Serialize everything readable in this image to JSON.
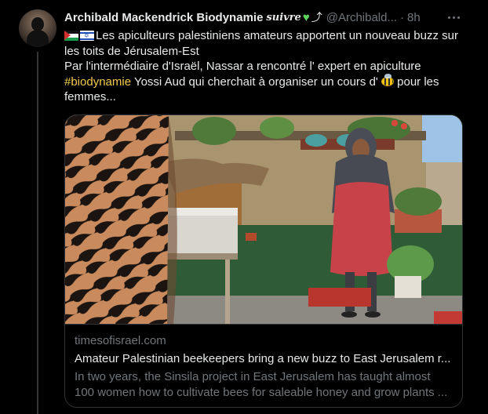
{
  "tweet": {
    "author_name": "Archibald Mackendrick Biodynamie",
    "author_suffix": "suivre",
    "handle": "@Archibald...",
    "separator": "·",
    "time": "8h",
    "text_lines": {
      "l1": "Les apiculteurs palestiniens amateurs apportent un nouveau buzz sur",
      "l2": "les toits de Jérusalem-Est",
      "l3": "Par l'intermédiaire d'Israël, Nassar a rencontré l' expert en apiculture",
      "l4_hashtag": "#biodynamie",
      "l4_rest": " Yossi Aud qui cherchait à organiser un cours d' ",
      "l4_end": " pour les",
      "l5": "femmes..."
    },
    "icons": {
      "flag1": "palestine-flag-icon",
      "flag2": "israel-flag-icon",
      "heart": "green-heart-icon",
      "arrow": "arrow-icon",
      "bee": "bee-icon",
      "more": "more-options-icon"
    },
    "colors": {
      "background": "#000000",
      "text": "#e7e9ea",
      "muted": "#71767b",
      "hashtag": "#f2c94c",
      "heart": "#5fd35a",
      "border": "#2f3336"
    }
  },
  "link_card": {
    "domain": "timesofisrael.com",
    "title": "Amateur Palestinian beekeepers bring a new buzz to East Jerusalem r...",
    "description_line1": "In two years, the Sinsila project in East Jerusalem has taught almost",
    "description_line2": "100 women how to cultivate bees for saleable honey and grow plants ..."
  }
}
